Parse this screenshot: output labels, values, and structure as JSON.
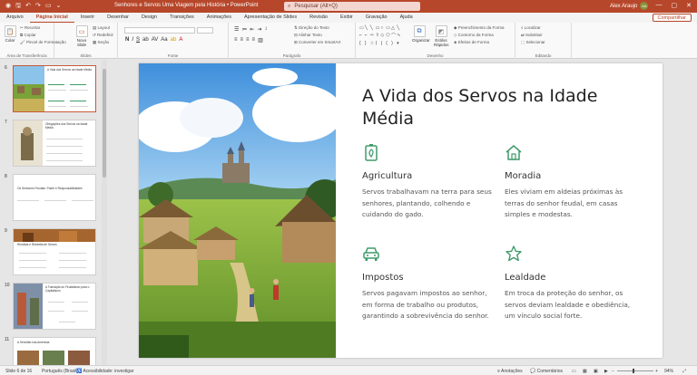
{
  "titlebar": {
    "title": "Senhores e Servos Uma Viagem pela História  •  PowerPoint",
    "search_placeholder": "Pesquisar (Alt+Q)",
    "user_name": "Alex Araujo",
    "user_initials": "AA"
  },
  "tabs": [
    "Arquivo",
    "Página Inicial",
    "Inserir",
    "Desenhar",
    "Design",
    "Transições",
    "Animações",
    "Apresentação de Slides",
    "Revisão",
    "Exibir",
    "Gravação",
    "Ajuda"
  ],
  "share_label": "Compartilhar",
  "ribbon": {
    "groups": {
      "clipboard": "Área de Transferência",
      "slides": "Slides",
      "font": "Fonte",
      "paragraph": "Parágrafo",
      "drawing": "Desenho",
      "editing": "Editando"
    },
    "paste": "Colar",
    "cut": "Recortar",
    "copy": "Copiar",
    "format_painter": "Pincel de Formatação",
    "new_slide": "Novo Slide",
    "layout": "Layout",
    "reset": "Redefinir",
    "section": "Seção",
    "text_direction": "Direção do Texto",
    "align_text": "Alinhar Texto",
    "convert_smartart": "Converter em SmartArt",
    "arrange": "Organizar",
    "quick_styles": "Estilos Rápidos",
    "shape_fill": "Preenchimento da Forma",
    "shape_outline": "Contorno da Forma",
    "shape_effects": "Efeitos de Forma",
    "find": "Localizar",
    "replace": "Substituir",
    "select": "Selecionar"
  },
  "thumbnails": [
    {
      "num": "6",
      "title": "A Vida dos Servos na Idade Média"
    },
    {
      "num": "7",
      "title": "Obrigações dos Servos na Idade Média"
    },
    {
      "num": "8",
      "title": "Os Senhores Feudais: Poder e Responsabilidades"
    },
    {
      "num": "9",
      "title": "Revoltas e Rebeldia de Servos"
    },
    {
      "num": "10",
      "title": "A Transição do Feudalismo para o Capitalismo"
    },
    {
      "num": "11",
      "title": "A Servidão nas Américas"
    }
  ],
  "slide": {
    "title": "A Vida dos Servos na Idade Média",
    "features": [
      {
        "heading": "Agricultura",
        "text": "Servos trabalhavam na terra para seus senhores, plantando, colhendo e cuidando do gado.",
        "icon": "battery-leaf-icon"
      },
      {
        "heading": "Moradia",
        "text": "Eles viviam em aldeias próximas às terras do senhor feudal, em casas simples e modestas.",
        "icon": "house-icon"
      },
      {
        "heading": "Impostos",
        "text": "Servos pagavam impostos ao senhor, em forma de trabalho ou produtos, garantindo a sobrevivência do senhor.",
        "icon": "car-icon"
      },
      {
        "heading": "Lealdade",
        "text": "Em troca da proteção do senhor, os servos deviam lealdade e obediência, um vínculo social forte.",
        "icon": "star-icon"
      }
    ],
    "accent_color": "#3f9b6a"
  },
  "statusbar": {
    "slide_counter": "Slide 6 de 16",
    "language": "Português (Brasil)",
    "accessibility": "Acessibilidade: investigar",
    "notes": "Anotações",
    "comments": "Comentários",
    "zoom": "94%"
  }
}
